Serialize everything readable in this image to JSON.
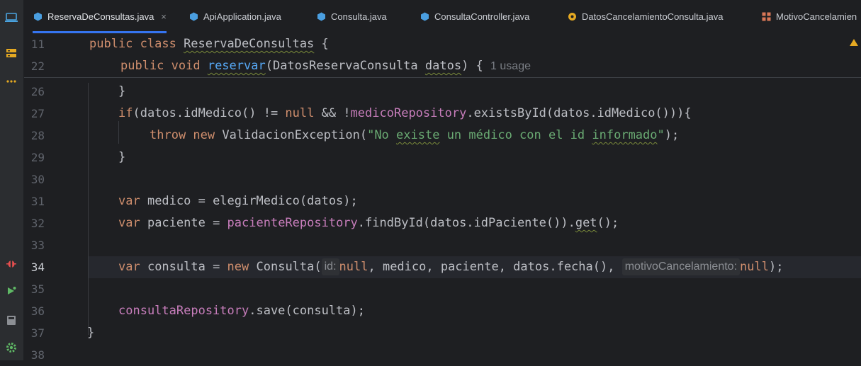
{
  "tabs": [
    {
      "label": "ReservaDeConsultas.java",
      "active": true,
      "icon": "java-class-icon",
      "close": "×"
    },
    {
      "label": "ApiApplication.java",
      "icon": "java-class-icon"
    },
    {
      "label": "Consulta.java",
      "icon": "java-class-icon"
    },
    {
      "label": "ConsultaController.java",
      "icon": "java-class-icon"
    },
    {
      "label": "DatosCancelamientoConsulta.java",
      "icon": "java-record-icon"
    },
    {
      "label": "MotivoCancelamien",
      "icon": "java-enum-icon"
    }
  ],
  "sticky": {
    "l11": "11",
    "l11_kw": "public class ",
    "l11_name": "ReservaDeConsultas",
    "l11_tail": " {",
    "l22": "22",
    "l22_kw": "public void ",
    "l22_method": "reservar",
    "l22_args": "(DatosReservaConsulta ",
    "l22_param": "datos",
    "l22_tail": ") {",
    "l22_usage": "1 usage"
  },
  "lines": {
    "n26": "26",
    "n27": "27",
    "n28": "28",
    "n29": "29",
    "n30": "30",
    "n31": "31",
    "n32": "32",
    "n33": "33",
    "n34": "34",
    "n35": "35",
    "n36": "36",
    "n37": "37",
    "n38": "38",
    "l26": "}",
    "l27_if": "if",
    "l27_a": "(datos.idMedico() != ",
    "l27_null": "null",
    "l27_b": " && !",
    "l27_repo": "medicoRepository",
    "l27_c": ".existsById(datos.idMedico())){",
    "l28_throw": "throw ",
    "l28_new": "new ",
    "l28_cls": "ValidacionException(",
    "l28_s1": "\"No ",
    "l28_s2": "existe",
    "l28_s3": " un médico con el id ",
    "l28_s4": "informado",
    "l28_s5": "\"",
    "l28_tail": ");",
    "l29": "}",
    "l31_var": "var ",
    "l31_rest": "medico = elegirMedico(datos);",
    "l32_var": "var ",
    "l32_a": "paciente = ",
    "l32_repo": "pacienteRepository",
    "l32_b": ".findById(datos.idPaciente()).",
    "l32_get": "get",
    "l32_c": "();",
    "l34_var": "var ",
    "l34_a": "consulta = ",
    "l34_new": "new ",
    "l34_b": "Consulta(",
    "l34_hint1": "id:",
    "l34_null1": "null",
    "l34_c": ", medico, paciente, datos.fecha(), ",
    "l34_hint2": "motivoCancelamiento:",
    "l34_null2": "null",
    "l34_d": ");",
    "l36_repo": "consultaRepository",
    "l36_rest": ".save(consulta);",
    "l37": "}"
  },
  "colors": {
    "accent": "#3574f0",
    "keyword": "#cf8e6d",
    "field": "#c77dbb",
    "string": "#6aab73",
    "method": "#56a8f5"
  }
}
